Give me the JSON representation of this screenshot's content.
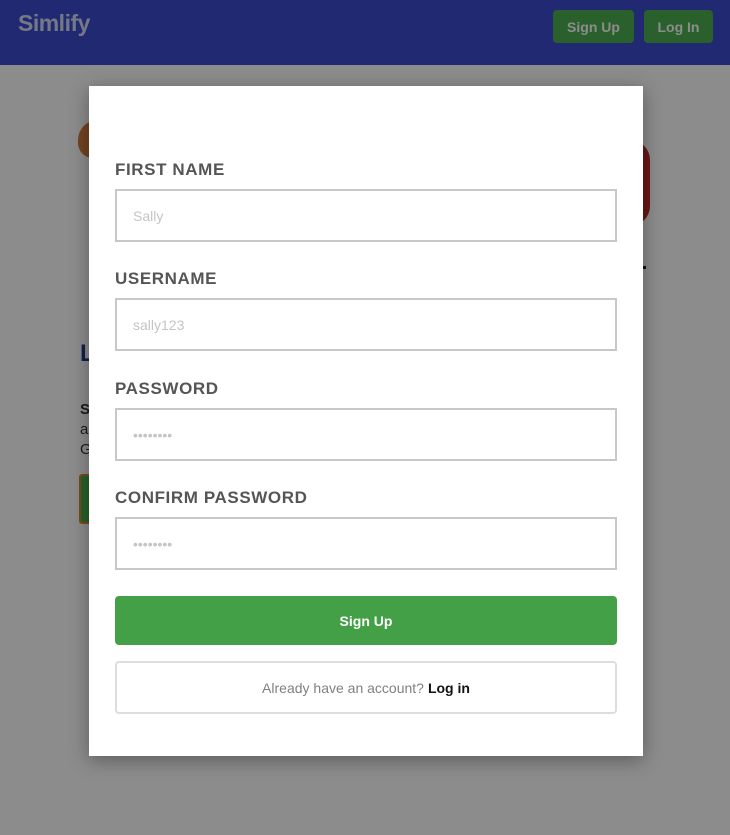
{
  "header": {
    "brand": "Simlify",
    "signup_label": "Sign Up",
    "login_label": "Log In"
  },
  "background_page": {
    "heading_fragment": "L",
    "text_fragment_bold": "S",
    "text_fragment_line2": "a",
    "text_fragment_line3": "G"
  },
  "signup_modal": {
    "fields": [
      {
        "label": "FIRST NAME",
        "placeholder": "Sally"
      },
      {
        "label": "USERNAME",
        "placeholder": "sally123"
      },
      {
        "label": "PASSWORD",
        "placeholder": "••••••••"
      },
      {
        "label": "CONFIRM PASSWORD",
        "placeholder": "••••••••"
      }
    ],
    "submit_label": "Sign Up",
    "login_prompt": "Already have an account?",
    "login_link": "Log in"
  },
  "colors": {
    "header_bg": "#3b4ccf",
    "button_green": "#43a047",
    "overlay": "rgba(0,0,0,0.45)"
  }
}
